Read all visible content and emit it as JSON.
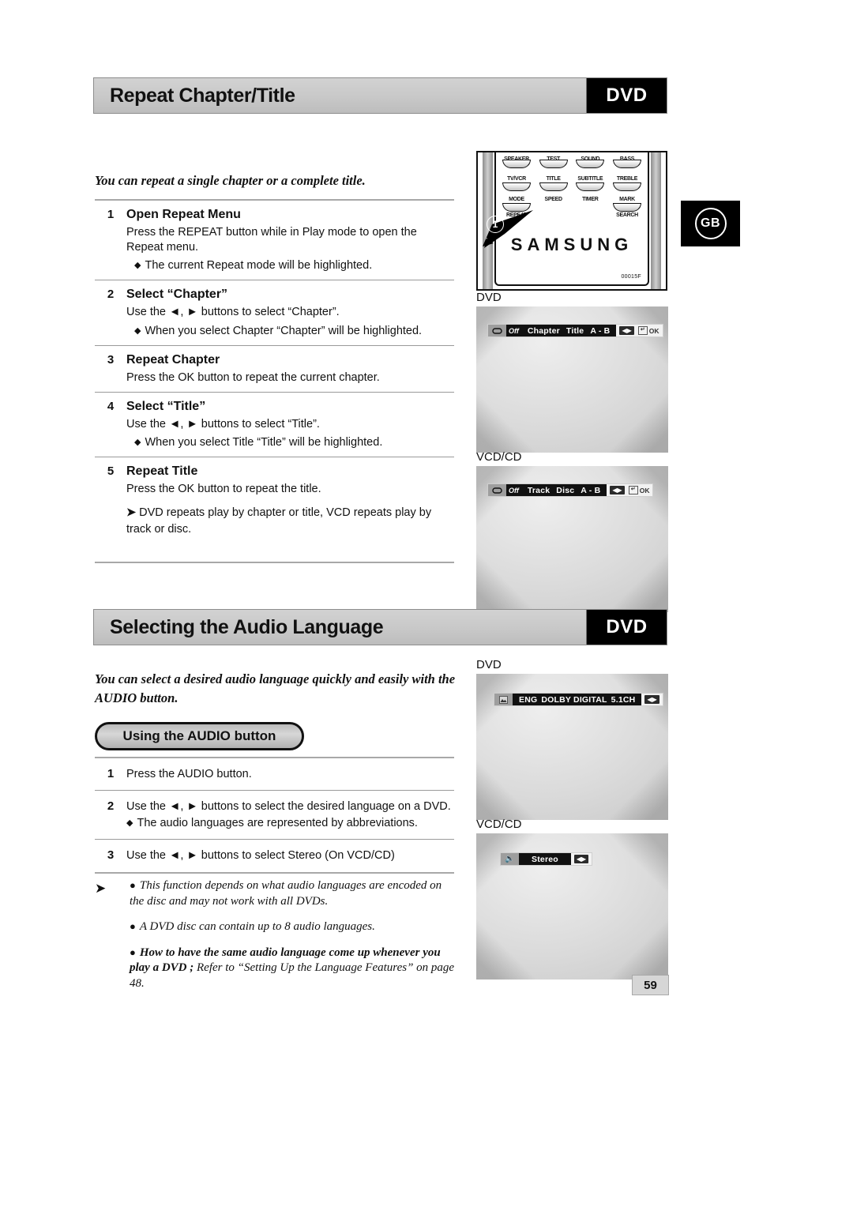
{
  "page_number": "59",
  "region_badge": "GB",
  "sections": [
    {
      "title": "Repeat Chapter/Title",
      "disc_tag": "DVD",
      "lead": "You can repeat a single chapter or a complete title.",
      "steps": [
        {
          "num": "1",
          "head": "Open Repeat Menu",
          "lines": [
            "Press the REPEAT button while in Play mode to open the Repeat menu."
          ],
          "bullets": [
            "The current Repeat mode will be highlighted."
          ]
        },
        {
          "num": "2",
          "head": "Select “Chapter”",
          "lines": [
            "Use the ◄, ► buttons to select “Chapter”."
          ],
          "bullets": [
            "When you select Chapter “Chapter” will be highlighted."
          ]
        },
        {
          "num": "3",
          "head": "Repeat Chapter",
          "lines": [
            "Press the OK button to repeat the current chapter."
          ],
          "bullets": []
        },
        {
          "num": "4",
          "head": "Select “Title”",
          "lines": [
            "Use the ◄, ► buttons to select “Title”."
          ],
          "bullets": [
            "When you select Title “Title” will be highlighted."
          ]
        },
        {
          "num": "5",
          "head": "Repeat Title",
          "lines": [
            "Press the OK button to repeat the title."
          ],
          "bullets": []
        }
      ],
      "note_line": "DVD repeats play by chapter or title, VCD repeats play by track or disc."
    },
    {
      "title": "Selecting the Audio Language",
      "disc_tag": "DVD",
      "lead_line1": "You can select a desired audio language quickly and easily with the",
      "lead_line2": "AUDIO button.",
      "pill_label": "Using the AUDIO button",
      "steps": [
        {
          "num": "1",
          "lines": [
            "Press the AUDIO button."
          ],
          "bullets": []
        },
        {
          "num": "2",
          "lines": [
            "Use the ◄, ► buttons to select the desired language on a DVD."
          ],
          "bullets": [
            "The audio languages are represented by abbreviations."
          ]
        },
        {
          "num": "3",
          "lines": [
            "Use the  ◄, ► buttons to select Stereo (On VCD/CD)"
          ],
          "bullets": []
        }
      ],
      "notes": [
        {
          "text": "This function depends on what audio languages are encoded on the disc and may not work with all DVDs.",
          "bold_prefix": ""
        },
        {
          "text": "A DVD disc can contain up to 8 audio languages.",
          "bold_prefix": ""
        },
        {
          "text": "Refer to “Setting Up the Language Features” on page 48.",
          "bold_prefix": "How to have the same audio language come up whenever you play a DVD ;"
        }
      ]
    }
  ],
  "remote": {
    "brand": "SAMSUNG",
    "model_code": "00015F",
    "callout_number": "1",
    "rows": [
      {
        "position": "top-cut",
        "labels": [
          "SPEAKER",
          "TEST",
          "SOUND MODE",
          "BASS"
        ]
      },
      {
        "position": "above",
        "labels": [
          "TV/VCR",
          "TITLE",
          "SUBTITLE",
          "TREBLE"
        ]
      },
      {
        "position": "above",
        "labels": [
          "MODE",
          "SPEED",
          "TIMER",
          "MARK"
        ]
      },
      {
        "position": "below",
        "labels": [
          "REPEAT",
          "SEARCH"
        ]
      }
    ]
  },
  "screens": {
    "repeat_dvd": {
      "label": "DVD",
      "icons": {
        "left": "repeat-loop-icon",
        "arrows": "left-right-arrows-icon",
        "ok": "ok-enter-icon"
      },
      "off_label": "Off",
      "items": [
        "Chapter",
        "Title",
        "A - B"
      ],
      "ok_label": "OK"
    },
    "repeat_vcd": {
      "label": "VCD/CD",
      "icons": {
        "left": "repeat-loop-icon",
        "arrows": "left-right-arrows-icon",
        "ok": "ok-enter-icon"
      },
      "off_label": "Off",
      "items": [
        "Track",
        "Disc",
        "A - B"
      ],
      "ok_label": "OK"
    },
    "audio_dvd": {
      "label": "DVD",
      "icons": {
        "left": "audio-language-icon",
        "arrows": "left-right-arrows-icon"
      },
      "items": [
        "ENG",
        "DOLBY DIGITAL",
        "5.1CH"
      ]
    },
    "audio_vcd": {
      "label": "VCD/CD",
      "icons": {
        "left": "speaker-icon",
        "arrows": "left-right-arrows-icon"
      },
      "items": [
        "Stereo"
      ]
    }
  }
}
